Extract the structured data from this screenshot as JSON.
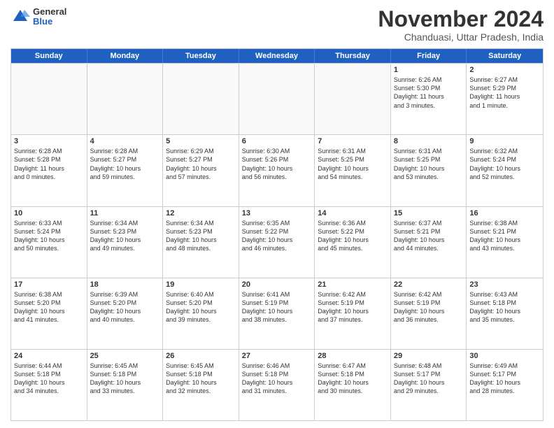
{
  "logo": {
    "general": "General",
    "blue": "Blue"
  },
  "title": "November 2024",
  "location": "Chanduasi, Uttar Pradesh, India",
  "header_days": [
    "Sunday",
    "Monday",
    "Tuesday",
    "Wednesday",
    "Thursday",
    "Friday",
    "Saturday"
  ],
  "rows": [
    [
      {
        "day": "",
        "text": "",
        "empty": true
      },
      {
        "day": "",
        "text": "",
        "empty": true
      },
      {
        "day": "",
        "text": "",
        "empty": true
      },
      {
        "day": "",
        "text": "",
        "empty": true
      },
      {
        "day": "",
        "text": "",
        "empty": true
      },
      {
        "day": "1",
        "text": "Sunrise: 6:26 AM\nSunset: 5:30 PM\nDaylight: 11 hours\nand 3 minutes.",
        "empty": false
      },
      {
        "day": "2",
        "text": "Sunrise: 6:27 AM\nSunset: 5:29 PM\nDaylight: 11 hours\nand 1 minute.",
        "empty": false
      }
    ],
    [
      {
        "day": "3",
        "text": "Sunrise: 6:28 AM\nSunset: 5:28 PM\nDaylight: 11 hours\nand 0 minutes.",
        "empty": false
      },
      {
        "day": "4",
        "text": "Sunrise: 6:28 AM\nSunset: 5:27 PM\nDaylight: 10 hours\nand 59 minutes.",
        "empty": false
      },
      {
        "day": "5",
        "text": "Sunrise: 6:29 AM\nSunset: 5:27 PM\nDaylight: 10 hours\nand 57 minutes.",
        "empty": false
      },
      {
        "day": "6",
        "text": "Sunrise: 6:30 AM\nSunset: 5:26 PM\nDaylight: 10 hours\nand 56 minutes.",
        "empty": false
      },
      {
        "day": "7",
        "text": "Sunrise: 6:31 AM\nSunset: 5:25 PM\nDaylight: 10 hours\nand 54 minutes.",
        "empty": false
      },
      {
        "day": "8",
        "text": "Sunrise: 6:31 AM\nSunset: 5:25 PM\nDaylight: 10 hours\nand 53 minutes.",
        "empty": false
      },
      {
        "day": "9",
        "text": "Sunrise: 6:32 AM\nSunset: 5:24 PM\nDaylight: 10 hours\nand 52 minutes.",
        "empty": false
      }
    ],
    [
      {
        "day": "10",
        "text": "Sunrise: 6:33 AM\nSunset: 5:24 PM\nDaylight: 10 hours\nand 50 minutes.",
        "empty": false
      },
      {
        "day": "11",
        "text": "Sunrise: 6:34 AM\nSunset: 5:23 PM\nDaylight: 10 hours\nand 49 minutes.",
        "empty": false
      },
      {
        "day": "12",
        "text": "Sunrise: 6:34 AM\nSunset: 5:23 PM\nDaylight: 10 hours\nand 48 minutes.",
        "empty": false
      },
      {
        "day": "13",
        "text": "Sunrise: 6:35 AM\nSunset: 5:22 PM\nDaylight: 10 hours\nand 46 minutes.",
        "empty": false
      },
      {
        "day": "14",
        "text": "Sunrise: 6:36 AM\nSunset: 5:22 PM\nDaylight: 10 hours\nand 45 minutes.",
        "empty": false
      },
      {
        "day": "15",
        "text": "Sunrise: 6:37 AM\nSunset: 5:21 PM\nDaylight: 10 hours\nand 44 minutes.",
        "empty": false
      },
      {
        "day": "16",
        "text": "Sunrise: 6:38 AM\nSunset: 5:21 PM\nDaylight: 10 hours\nand 43 minutes.",
        "empty": false
      }
    ],
    [
      {
        "day": "17",
        "text": "Sunrise: 6:38 AM\nSunset: 5:20 PM\nDaylight: 10 hours\nand 41 minutes.",
        "empty": false
      },
      {
        "day": "18",
        "text": "Sunrise: 6:39 AM\nSunset: 5:20 PM\nDaylight: 10 hours\nand 40 minutes.",
        "empty": false
      },
      {
        "day": "19",
        "text": "Sunrise: 6:40 AM\nSunset: 5:20 PM\nDaylight: 10 hours\nand 39 minutes.",
        "empty": false
      },
      {
        "day": "20",
        "text": "Sunrise: 6:41 AM\nSunset: 5:19 PM\nDaylight: 10 hours\nand 38 minutes.",
        "empty": false
      },
      {
        "day": "21",
        "text": "Sunrise: 6:42 AM\nSunset: 5:19 PM\nDaylight: 10 hours\nand 37 minutes.",
        "empty": false
      },
      {
        "day": "22",
        "text": "Sunrise: 6:42 AM\nSunset: 5:19 PM\nDaylight: 10 hours\nand 36 minutes.",
        "empty": false
      },
      {
        "day": "23",
        "text": "Sunrise: 6:43 AM\nSunset: 5:18 PM\nDaylight: 10 hours\nand 35 minutes.",
        "empty": false
      }
    ],
    [
      {
        "day": "24",
        "text": "Sunrise: 6:44 AM\nSunset: 5:18 PM\nDaylight: 10 hours\nand 34 minutes.",
        "empty": false
      },
      {
        "day": "25",
        "text": "Sunrise: 6:45 AM\nSunset: 5:18 PM\nDaylight: 10 hours\nand 33 minutes.",
        "empty": false
      },
      {
        "day": "26",
        "text": "Sunrise: 6:45 AM\nSunset: 5:18 PM\nDaylight: 10 hours\nand 32 minutes.",
        "empty": false
      },
      {
        "day": "27",
        "text": "Sunrise: 6:46 AM\nSunset: 5:18 PM\nDaylight: 10 hours\nand 31 minutes.",
        "empty": false
      },
      {
        "day": "28",
        "text": "Sunrise: 6:47 AM\nSunset: 5:18 PM\nDaylight: 10 hours\nand 30 minutes.",
        "empty": false
      },
      {
        "day": "29",
        "text": "Sunrise: 6:48 AM\nSunset: 5:17 PM\nDaylight: 10 hours\nand 29 minutes.",
        "empty": false
      },
      {
        "day": "30",
        "text": "Sunrise: 6:49 AM\nSunset: 5:17 PM\nDaylight: 10 hours\nand 28 minutes.",
        "empty": false
      }
    ]
  ]
}
